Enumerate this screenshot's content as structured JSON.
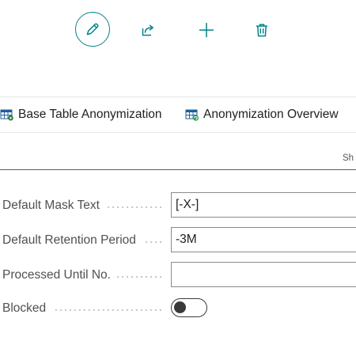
{
  "toolbar": {
    "edit_icon": "pencil-icon",
    "share_icon": "share-icon",
    "new_icon": "plus-icon",
    "delete_icon": "trash-icon",
    "accent_color": "#008489"
  },
  "actions": [
    {
      "label": "Base Table Anonymization",
      "icon": "table-settings-icon"
    },
    {
      "label": "Anonymization Overview",
      "icon": "table-refresh-icon"
    }
  ],
  "tabs": {
    "partial_label": "Sh"
  },
  "fields": {
    "default_mask_text": {
      "label": "Default Mask Text",
      "value": "[-X-]"
    },
    "default_retention_period": {
      "label": "Default Retention Period",
      "value": "-3M"
    },
    "processed_until_no": {
      "label": "Processed Until No.",
      "value": ""
    },
    "blocked": {
      "label": "Blocked",
      "value": false
    }
  }
}
